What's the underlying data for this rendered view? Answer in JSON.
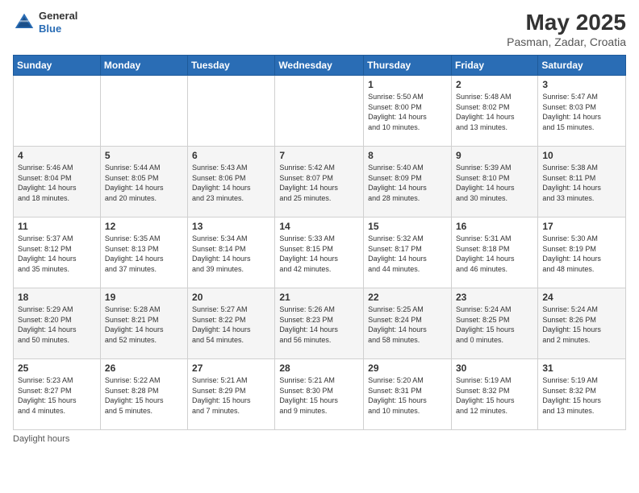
{
  "header": {
    "logo_general": "General",
    "logo_blue": "Blue",
    "month_year": "May 2025",
    "location": "Pasman, Zadar, Croatia"
  },
  "days_of_week": [
    "Sunday",
    "Monday",
    "Tuesday",
    "Wednesday",
    "Thursday",
    "Friday",
    "Saturday"
  ],
  "weeks": [
    [
      {
        "num": "",
        "detail": ""
      },
      {
        "num": "",
        "detail": ""
      },
      {
        "num": "",
        "detail": ""
      },
      {
        "num": "",
        "detail": ""
      },
      {
        "num": "1",
        "detail": "Sunrise: 5:50 AM\nSunset: 8:00 PM\nDaylight: 14 hours\nand 10 minutes."
      },
      {
        "num": "2",
        "detail": "Sunrise: 5:48 AM\nSunset: 8:02 PM\nDaylight: 14 hours\nand 13 minutes."
      },
      {
        "num": "3",
        "detail": "Sunrise: 5:47 AM\nSunset: 8:03 PM\nDaylight: 14 hours\nand 15 minutes."
      }
    ],
    [
      {
        "num": "4",
        "detail": "Sunrise: 5:46 AM\nSunset: 8:04 PM\nDaylight: 14 hours\nand 18 minutes."
      },
      {
        "num": "5",
        "detail": "Sunrise: 5:44 AM\nSunset: 8:05 PM\nDaylight: 14 hours\nand 20 minutes."
      },
      {
        "num": "6",
        "detail": "Sunrise: 5:43 AM\nSunset: 8:06 PM\nDaylight: 14 hours\nand 23 minutes."
      },
      {
        "num": "7",
        "detail": "Sunrise: 5:42 AM\nSunset: 8:07 PM\nDaylight: 14 hours\nand 25 minutes."
      },
      {
        "num": "8",
        "detail": "Sunrise: 5:40 AM\nSunset: 8:09 PM\nDaylight: 14 hours\nand 28 minutes."
      },
      {
        "num": "9",
        "detail": "Sunrise: 5:39 AM\nSunset: 8:10 PM\nDaylight: 14 hours\nand 30 minutes."
      },
      {
        "num": "10",
        "detail": "Sunrise: 5:38 AM\nSunset: 8:11 PM\nDaylight: 14 hours\nand 33 minutes."
      }
    ],
    [
      {
        "num": "11",
        "detail": "Sunrise: 5:37 AM\nSunset: 8:12 PM\nDaylight: 14 hours\nand 35 minutes."
      },
      {
        "num": "12",
        "detail": "Sunrise: 5:35 AM\nSunset: 8:13 PM\nDaylight: 14 hours\nand 37 minutes."
      },
      {
        "num": "13",
        "detail": "Sunrise: 5:34 AM\nSunset: 8:14 PM\nDaylight: 14 hours\nand 39 minutes."
      },
      {
        "num": "14",
        "detail": "Sunrise: 5:33 AM\nSunset: 8:15 PM\nDaylight: 14 hours\nand 42 minutes."
      },
      {
        "num": "15",
        "detail": "Sunrise: 5:32 AM\nSunset: 8:17 PM\nDaylight: 14 hours\nand 44 minutes."
      },
      {
        "num": "16",
        "detail": "Sunrise: 5:31 AM\nSunset: 8:18 PM\nDaylight: 14 hours\nand 46 minutes."
      },
      {
        "num": "17",
        "detail": "Sunrise: 5:30 AM\nSunset: 8:19 PM\nDaylight: 14 hours\nand 48 minutes."
      }
    ],
    [
      {
        "num": "18",
        "detail": "Sunrise: 5:29 AM\nSunset: 8:20 PM\nDaylight: 14 hours\nand 50 minutes."
      },
      {
        "num": "19",
        "detail": "Sunrise: 5:28 AM\nSunset: 8:21 PM\nDaylight: 14 hours\nand 52 minutes."
      },
      {
        "num": "20",
        "detail": "Sunrise: 5:27 AM\nSunset: 8:22 PM\nDaylight: 14 hours\nand 54 minutes."
      },
      {
        "num": "21",
        "detail": "Sunrise: 5:26 AM\nSunset: 8:23 PM\nDaylight: 14 hours\nand 56 minutes."
      },
      {
        "num": "22",
        "detail": "Sunrise: 5:25 AM\nSunset: 8:24 PM\nDaylight: 14 hours\nand 58 minutes."
      },
      {
        "num": "23",
        "detail": "Sunrise: 5:24 AM\nSunset: 8:25 PM\nDaylight: 15 hours\nand 0 minutes."
      },
      {
        "num": "24",
        "detail": "Sunrise: 5:24 AM\nSunset: 8:26 PM\nDaylight: 15 hours\nand 2 minutes."
      }
    ],
    [
      {
        "num": "25",
        "detail": "Sunrise: 5:23 AM\nSunset: 8:27 PM\nDaylight: 15 hours\nand 4 minutes."
      },
      {
        "num": "26",
        "detail": "Sunrise: 5:22 AM\nSunset: 8:28 PM\nDaylight: 15 hours\nand 5 minutes."
      },
      {
        "num": "27",
        "detail": "Sunrise: 5:21 AM\nSunset: 8:29 PM\nDaylight: 15 hours\nand 7 minutes."
      },
      {
        "num": "28",
        "detail": "Sunrise: 5:21 AM\nSunset: 8:30 PM\nDaylight: 15 hours\nand 9 minutes."
      },
      {
        "num": "29",
        "detail": "Sunrise: 5:20 AM\nSunset: 8:31 PM\nDaylight: 15 hours\nand 10 minutes."
      },
      {
        "num": "30",
        "detail": "Sunrise: 5:19 AM\nSunset: 8:32 PM\nDaylight: 15 hours\nand 12 minutes."
      },
      {
        "num": "31",
        "detail": "Sunrise: 5:19 AM\nSunset: 8:32 PM\nDaylight: 15 hours\nand 13 minutes."
      }
    ]
  ],
  "footer": {
    "daylight_hours_label": "Daylight hours"
  }
}
